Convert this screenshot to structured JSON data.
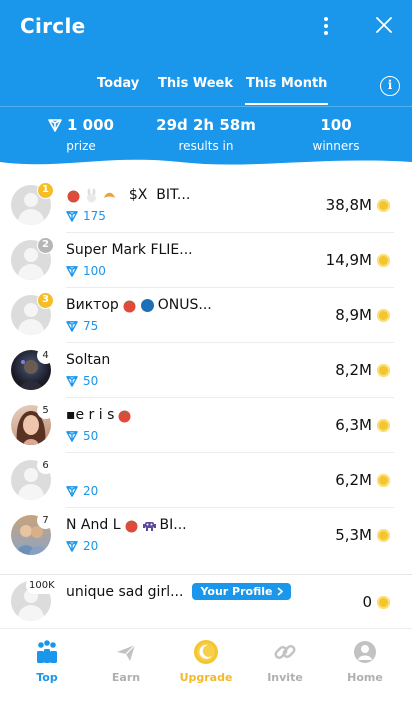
{
  "header": {
    "title": "Circle",
    "tabs": [
      {
        "label": "Today",
        "active": false
      },
      {
        "label": "This Week",
        "active": false
      },
      {
        "label": "This Month",
        "active": true
      }
    ],
    "info_label": "i"
  },
  "stats": [
    {
      "value": "1 000",
      "label": "prize",
      "icon": "diamond-icon"
    },
    {
      "value": "29d 2h 58m",
      "label": "results in"
    },
    {
      "value": "100",
      "label": "winners"
    }
  ],
  "leaderboard": [
    {
      "rank": "1",
      "name": "  $X  BIT...",
      "name_emojis": [
        "tomato",
        "rabbit",
        "croissant"
      ],
      "points": "175",
      "score": "38,8M",
      "avatar": "default",
      "badge": "gold"
    },
    {
      "rank": "2",
      "name": "Super Mark FLIE...",
      "points": "100",
      "score": "14,9M",
      "avatar": "default",
      "badge": "silver"
    },
    {
      "rank": "3",
      "name": "Виктор",
      "name_suffix": "ONUS...",
      "points": "75",
      "score": "8,9M",
      "avatar": "default",
      "badge": "gold"
    },
    {
      "rank": "4",
      "name": "Soltan",
      "points": "50",
      "score": "8,2M",
      "avatar": "photo-dark",
      "badge": "plain"
    },
    {
      "rank": "5",
      "name": "▪e r i s",
      "points": "50",
      "score": "6,3M",
      "avatar": "photo-girl",
      "badge": "plain"
    },
    {
      "rank": "6",
      "name": "",
      "points": "20",
      "score": "6,2M",
      "avatar": "default",
      "badge": "plain"
    },
    {
      "rank": "7",
      "name": "N And L",
      "name_suffix": "BI...",
      "points": "20",
      "score": "5,3M",
      "avatar": "photo-man",
      "badge": "plain"
    }
  ],
  "my_profile": {
    "rank": "100K",
    "name": "unique sad girl...",
    "pill_label": "Your Profile",
    "score": "0"
  },
  "nav": [
    {
      "label": "Top",
      "icon": "podium-icon",
      "color": "#1a96ea"
    },
    {
      "label": "Earn",
      "icon": "plane-icon",
      "color": "#b0b0b0"
    },
    {
      "label": "Upgrade",
      "icon": "moon-coin-icon",
      "color": "#f5b82a"
    },
    {
      "label": "Invite",
      "icon": "link-icon",
      "color": "#b0b0b0"
    },
    {
      "label": "Home",
      "icon": "home-avatar-icon",
      "color": "#b0b0b0"
    }
  ],
  "colors": {
    "accent": "#1a96ea",
    "coin": "#f5c530"
  }
}
